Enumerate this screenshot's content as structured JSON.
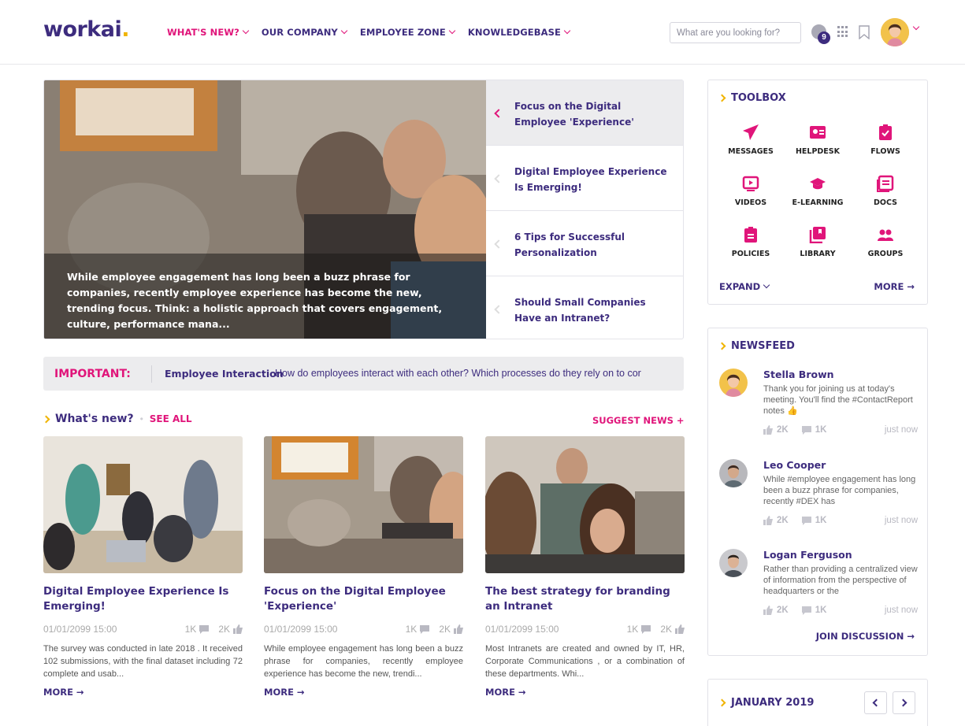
{
  "header": {
    "logo_text": "workai",
    "logo_dot": ".",
    "nav": [
      {
        "label": "WHAT'S NEW?",
        "active": true
      },
      {
        "label": "OUR COMPANY",
        "active": false
      },
      {
        "label": "EMPLOYEE ZONE",
        "active": false
      },
      {
        "label": "KNOWLEDGEBASE",
        "active": false
      }
    ],
    "search_placeholder": "What are you looking for?",
    "notification_count": "9"
  },
  "hero": {
    "caption": "While employee engagement has long been a buzz phrase for companies, recently employee experience has become the new, trending focus. Think: a holistic approach that covers engagement, culture, performance mana...",
    "items": [
      {
        "title": "Focus on the Digital Employee 'Experience'",
        "active": true
      },
      {
        "title": "Digital Employee Experience Is Emerging!",
        "active": false
      },
      {
        "title": "6 Tips for Successful Personalization",
        "active": false
      },
      {
        "title": "Should Small Companies Have an Intranet?",
        "active": false
      }
    ]
  },
  "important": {
    "label": "IMPORTANT:",
    "tag": "Employee Interaction",
    "text": "How do employees interact with each other? Which processes do they rely on to cor"
  },
  "whats_new": {
    "title": "What's new?",
    "see_all": "SEE ALL",
    "suggest": "SUGGEST NEWS +",
    "cards": [
      {
        "title": "Digital Employee Experience Is Emerging!",
        "date": "01/01/2099 15:00",
        "comments": "1K",
        "likes": "2K",
        "body": "The survey was conducted in late 2018 . It received 102 submissions, with the final dataset including 72 complete and usab...",
        "more": "MORE →"
      },
      {
        "title": "Focus on the Digital Employee 'Experience'",
        "date": "01/01/2099 15:00",
        "comments": "1K",
        "likes": "2K",
        "body": "While employee engagement has long been a buzz phrase for companies, recently employee experience has become the new, trendi...",
        "more": "MORE →"
      },
      {
        "title": "The best strategy for branding an Intranet",
        "date": "01/01/2099 15:00",
        "comments": "1K",
        "likes": "2K",
        "body": "Most Intranets are created and owned by IT, HR, Corporate Communications , or a combination of these departments. Whi...",
        "more": "MORE →"
      }
    ]
  },
  "toolbox": {
    "title": "TOOLBOX",
    "tools": [
      {
        "label": "MESSAGES",
        "icon": "paper-plane-icon"
      },
      {
        "label": "HELPDESK",
        "icon": "contact-card-icon"
      },
      {
        "label": "FLOWS",
        "icon": "clipboard-check-icon"
      },
      {
        "label": "VIDEOS",
        "icon": "play-screen-icon"
      },
      {
        "label": "E-LEARNING",
        "icon": "graduation-cap-icon"
      },
      {
        "label": "DOCS",
        "icon": "docs-icon"
      },
      {
        "label": "POLICIES",
        "icon": "policy-clipboard-icon"
      },
      {
        "label": "LIBRARY",
        "icon": "library-icon"
      },
      {
        "label": "GROUPS",
        "icon": "groups-icon"
      }
    ],
    "expand": "EXPAND",
    "more": "MORE →"
  },
  "newsfeed": {
    "title": "NEWSFEED",
    "posts": [
      {
        "name": "Stella Brown",
        "message": "Thank you for joining us at today's meeting. You'll find the #ContactReport notes 👍",
        "likes": "2K",
        "comments": "1K",
        "when": "just now"
      },
      {
        "name": "Leo Cooper",
        "message": "While #employee engagement has long been a buzz phrase for companies, recently #DEX has",
        "likes": "2K",
        "comments": "1K",
        "when": "just now"
      },
      {
        "name": "Logan Ferguson",
        "message": "Rather than providing a centralized view of information from the perspective of headquarters or the",
        "likes": "2K",
        "comments": "1K",
        "when": "just now"
      }
    ],
    "join": "JOIN DISCUSSION →"
  },
  "calendar": {
    "title": "JANUARY 2019"
  },
  "colors": {
    "brand": "#3d2c7e",
    "accent": "#e0157a",
    "yellow": "#f0b400"
  }
}
